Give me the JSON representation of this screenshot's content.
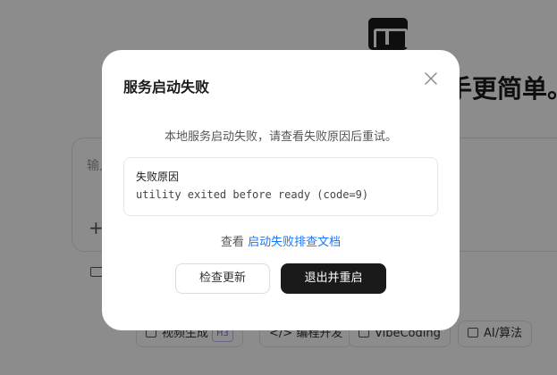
{
  "background": {
    "headline": "上手更简单。",
    "chat_placeholder": "输入",
    "chips": [
      {
        "label": "视频生成",
        "badge": "H3"
      },
      {
        "label": "编程开发"
      },
      {
        "label": "VibeCoding"
      },
      {
        "label": "AI/算法"
      }
    ]
  },
  "modal": {
    "title": "服务启动失败",
    "message": "本地服务启动失败，请查看失败原因后重试。",
    "reason_label": "失败原因",
    "reason_detail": "utility exited before ready (code=9)",
    "doc_prefix": "查看",
    "doc_link": "启动失败排查文档",
    "check_update_label": "检查更新",
    "quit_restart_label": "退出并重启"
  },
  "colors": {
    "primary_button": "#1a1a1a",
    "link": "#1677ff",
    "overlay": "rgba(0,0,0,0.45)"
  }
}
